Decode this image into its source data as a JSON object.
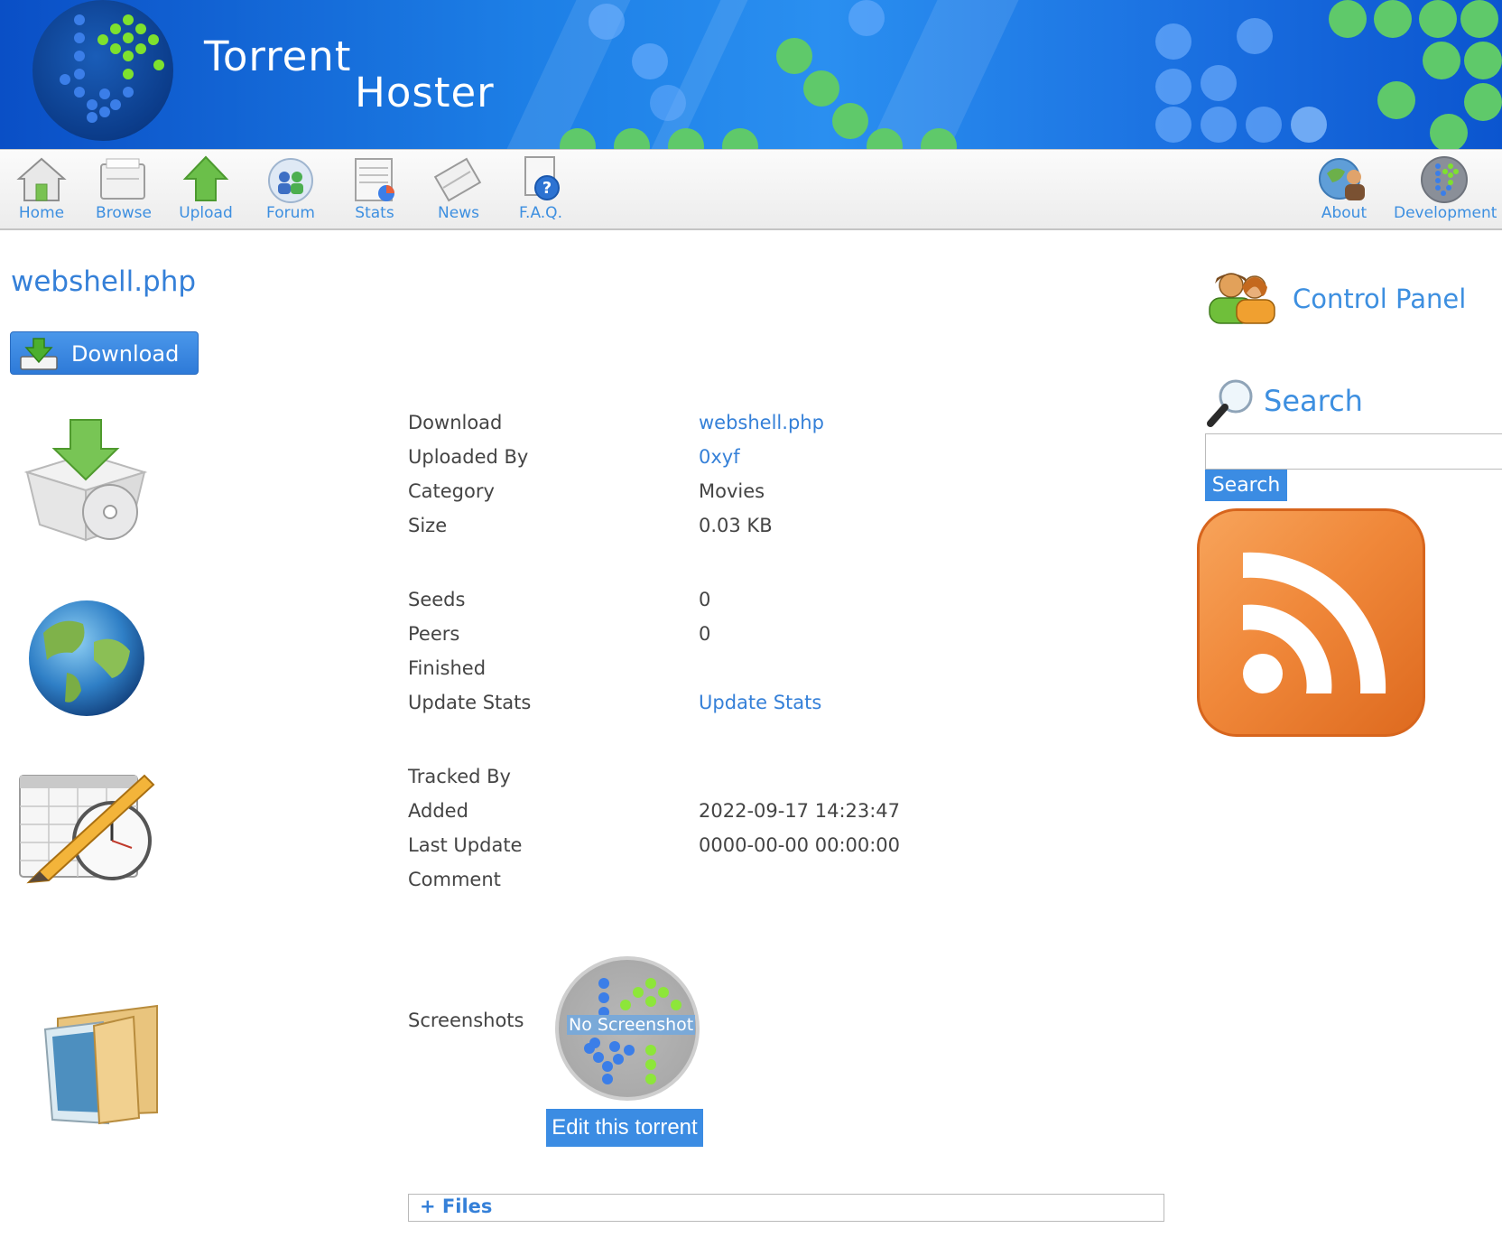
{
  "banner": {
    "title_line1": "Torrent",
    "title_line2": "Hoster"
  },
  "nav": {
    "items": [
      {
        "label": "Home",
        "icon": "home-icon"
      },
      {
        "label": "Browse",
        "icon": "browse-icon"
      },
      {
        "label": "Upload",
        "icon": "upload-icon"
      },
      {
        "label": "Forum",
        "icon": "forum-icon"
      },
      {
        "label": "Stats",
        "icon": "stats-icon"
      },
      {
        "label": "News",
        "icon": "news-icon"
      },
      {
        "label": "F.A.Q.",
        "icon": "faq-icon"
      },
      {
        "label": "About",
        "icon": "about-icon"
      },
      {
        "label": "Development",
        "icon": "development-icon"
      }
    ]
  },
  "torrent": {
    "title": "webshell.php",
    "download_button": "Download",
    "details": {
      "download_label": "Download",
      "download_value": "webshell.php",
      "uploaded_by_label": "Uploaded By",
      "uploaded_by_value": "0xyf",
      "category_label": "Category",
      "category_value": "Movies",
      "size_label": "Size",
      "size_value": "0.03 KB",
      "seeds_label": "Seeds",
      "seeds_value": "0",
      "peers_label": "Peers",
      "peers_value": "0",
      "finished_label": "Finished",
      "update_stats_label": "Update Stats",
      "update_stats_link": "Update Stats",
      "tracked_by_label": "Tracked By",
      "added_label": "Added",
      "added_value": "2022-09-17 14:23:47",
      "last_update_label": "Last Update",
      "last_update_value": "0000-00-00 00:00:00",
      "comment_label": "Comment",
      "screenshots_label": "Screenshots",
      "no_screenshot_text": "No Screenshot"
    },
    "edit_button": "Edit this torrent",
    "files_toggle": "+ Files"
  },
  "sidebar": {
    "control_panel": "Control Panel",
    "search_heading": "Search",
    "search_button": "Search",
    "search_value": ""
  },
  "colors": {
    "link": "#3580d8",
    "button": "#3b8ce3",
    "dot_green": "#7ee12e",
    "dot_blue": "#3b7ee8"
  }
}
